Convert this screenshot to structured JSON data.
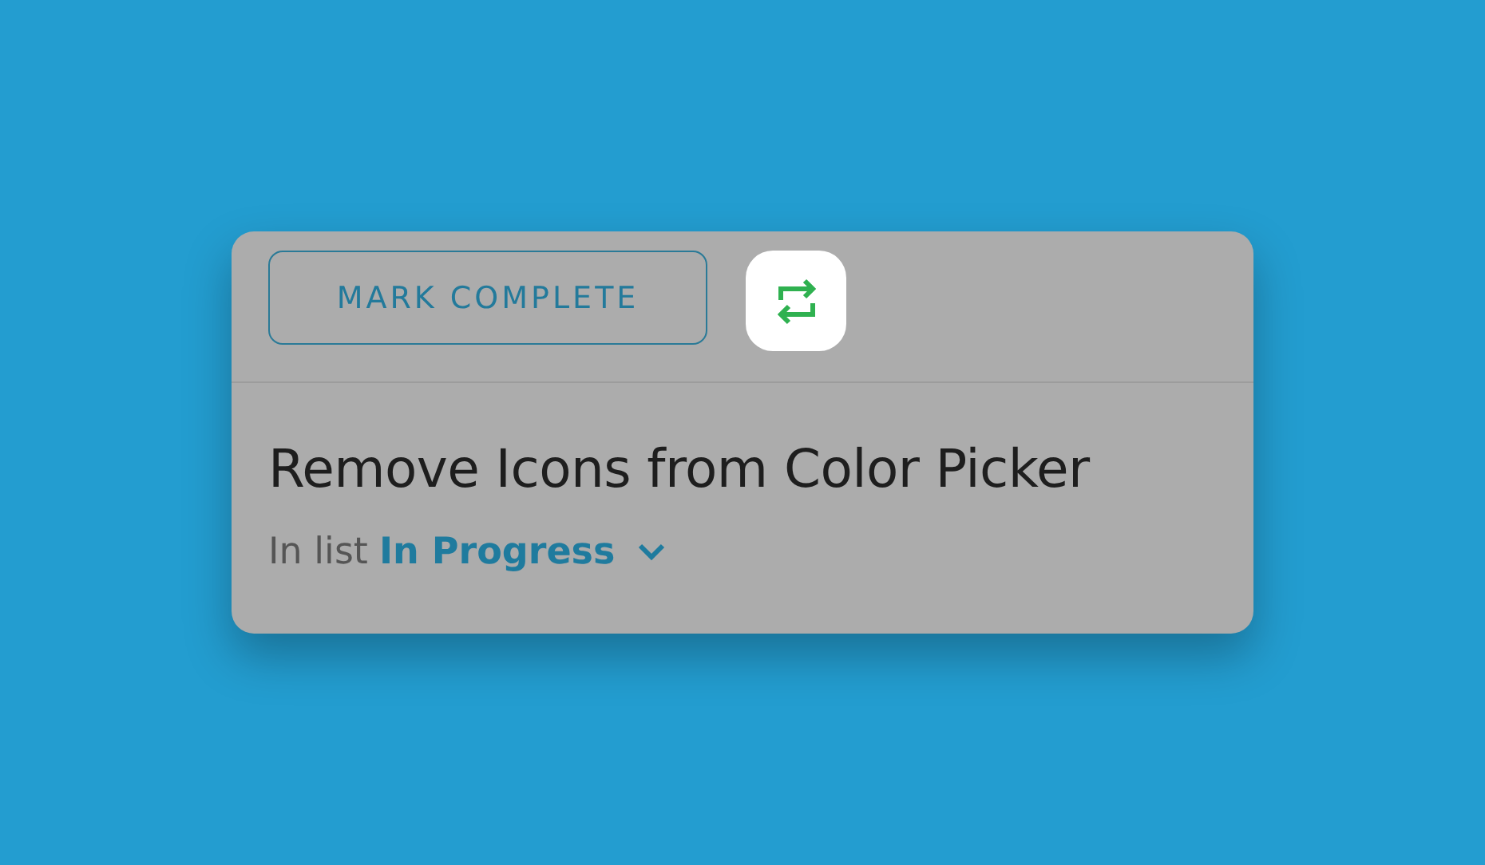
{
  "toolbar": {
    "mark_complete_button": "MARK COMPLETE"
  },
  "task": {
    "title": "Remove Icons from Color Picker",
    "list_label": "In list",
    "list_name": "In Progress"
  }
}
